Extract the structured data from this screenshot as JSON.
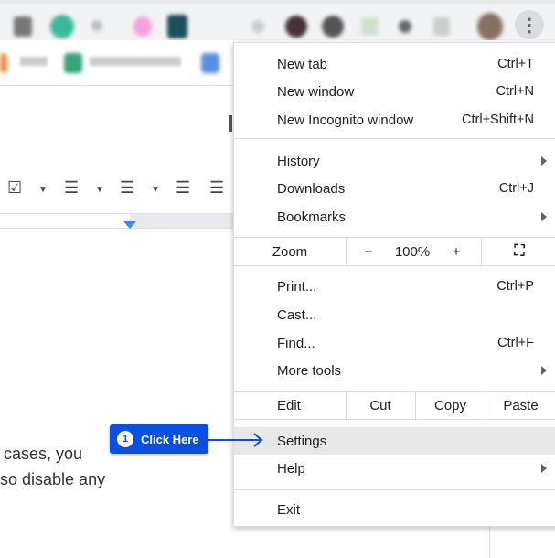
{
  "browser": {
    "menu_icon": "more-vert-icon"
  },
  "document": {
    "lines": [
      "cases, you",
      "so disable any"
    ]
  },
  "menu": {
    "items_top": [
      {
        "label": "New tab",
        "shortcut": "Ctrl+T"
      },
      {
        "label": "New window",
        "shortcut": "Ctrl+N"
      },
      {
        "label": "New Incognito window",
        "shortcut": "Ctrl+Shift+N"
      }
    ],
    "items_nav": [
      {
        "label": "History"
      },
      {
        "label": "Downloads",
        "shortcut": "Ctrl+J"
      },
      {
        "label": "Bookmarks"
      }
    ],
    "zoom": {
      "label": "Zoom",
      "minus": "−",
      "value": "100%",
      "plus": "+"
    },
    "items_mid": [
      {
        "label": "Print...",
        "shortcut": "Ctrl+P"
      },
      {
        "label": "Cast..."
      },
      {
        "label": "Find...",
        "shortcut": "Ctrl+F"
      },
      {
        "label": "More tools"
      }
    ],
    "edit": {
      "label": "Edit",
      "cut": "Cut",
      "copy": "Copy",
      "paste": "Paste"
    },
    "settings": "Settings",
    "help": "Help",
    "exit": "Exit"
  },
  "callout": {
    "number": "1",
    "text": "Click Here",
    "color": "#0a4fe0"
  }
}
